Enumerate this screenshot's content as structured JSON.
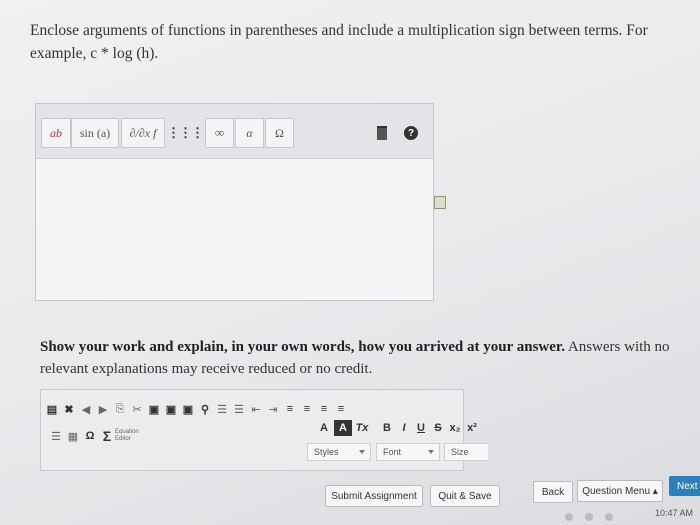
{
  "instructions": {
    "line1": "Enclose arguments of functions in parentheses and include a multiplication sign between terms. For",
    "line2_prefix": "example, ",
    "line2_math": "c * log (h)",
    "line2_suffix": "."
  },
  "math_toolbar": {
    "superscript": "ab",
    "sin": "sin (a)",
    "partial": "∂/∂x f",
    "matrix": "⋮⋮⋮",
    "infinity": "∞",
    "alpha": "α",
    "omega": "Ω"
  },
  "explanation": {
    "bold": "Show your work and explain, in your own words, how you arrived at your answer.",
    "normal": " Answers with no relevant explanations may receive reduced or no credit."
  },
  "rich_editor": {
    "equation_editor_label": "Equation Editor",
    "format_buttons": [
      "A",
      "A",
      "Tx",
      "B",
      "I",
      "U",
      "S",
      "x₂",
      "x²"
    ],
    "styles": "Styles",
    "font": "Font",
    "size": "Size"
  },
  "footer": {
    "submit": "Submit Assignment",
    "quit_save": "Quit & Save",
    "back": "Back",
    "question_menu": "Question Menu ▴",
    "next": "Next",
    "time": "10:47 AM"
  }
}
